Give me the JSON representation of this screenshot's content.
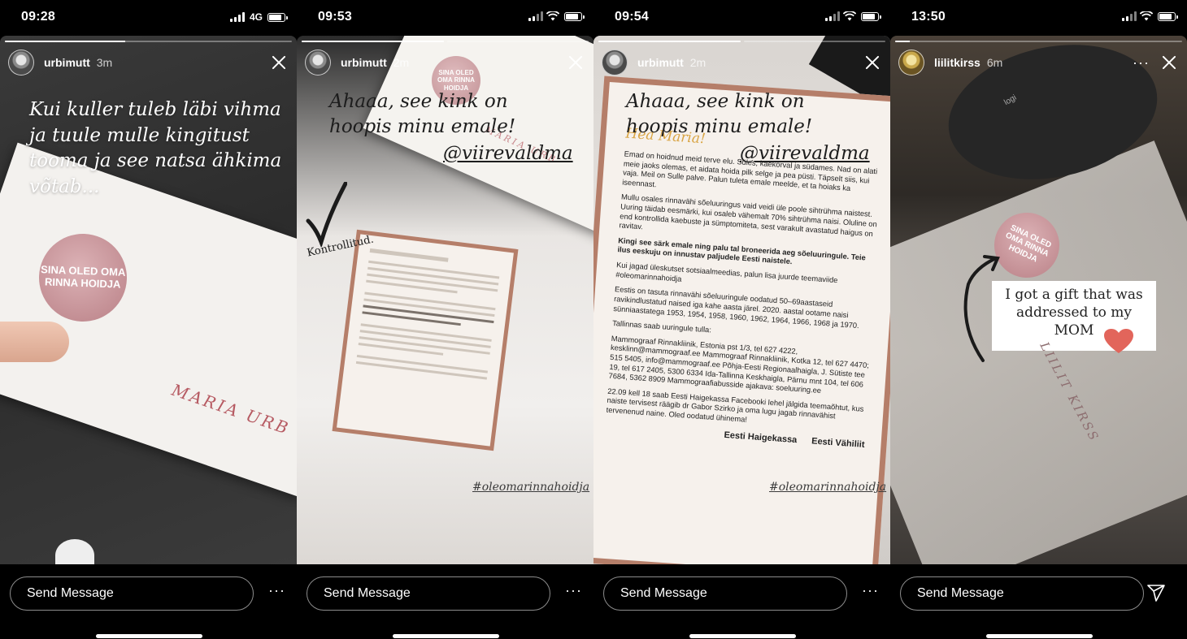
{
  "message_placeholder": "Send Message",
  "more_label": "···",
  "stories": [
    {
      "time": "09:28",
      "network": "4G",
      "username": "urbimutt",
      "ago": "3m",
      "caption": "Kui kuller tuleb läbi vihma ja tuule mulle kingitust tooma ja see natsa ähkima võtab...",
      "sticker": "SINA OLED OMA RINNA HOIDJA",
      "handwriting": "MARIA URB",
      "progress": 0.42
    },
    {
      "time": "09:53",
      "username": "urbimutt",
      "ago": "2m",
      "caption": "Ahaaa, see kink on hoopis minu emale!",
      "mention": "@viirevaldma",
      "check_label": "Kontrollitud.",
      "sticker": "SINA OLED OMA RINNA HOIDJA",
      "handwriting": "MARIA URB",
      "hashtag": "#oleomarinnahoidja",
      "progress": 0.5
    },
    {
      "time": "09:54",
      "username": "urbimutt",
      "ago": "2m",
      "caption": "Ahaaa, see kink on hoopis minu emale!",
      "mention": "@viirevaldma",
      "hashtag": "#oleomarinnahoidja",
      "greeting": "Hea Maria!",
      "letter_paragraphs": [
        "Emad on hoidnud meid terve elu. Süles, käekõrval ja südames. Nad on alati meie jaoks olemas, et aidata hoida pilk selge ja pea püsti. Täpselt siis, kui vaja. Meil on Sulle palve. Palun tuleta emale meelde, et ta hoiaks ka iseennast.",
        "Mullu osales rinnavähi sõeluuringus vaid veidi üle poole sihtrühma naistest. Uuring täidab eesmärki, kui osaleb vähemalt 70% sihtrühma naisi. Oluline on end kontrollida kaebuste ja sümptomiteta, sest varakult avastatud haigus on ravitav.",
        "Kingi see särk emale ning palu tal broneerida aeg sõeluuringule. Teie ilus eeskuju on innustav paljudele Eesti naistele.",
        "Kui jagad üleskutset sotsiaalmeedias, palun lisa juurde teemaviide #oleomarinnahoidja",
        "Eestis on tasuta rinnavähi sõeluuringule oodatud 50–69aastaseid ravikindlustatud naised iga kahe aasta järel. 2020. aastal ootame naisi sünniaastatega 1953, 1954, 1958, 1960, 1962, 1964, 1966, 1968 ja 1970.",
        "Tallinnas saab uuringule tulla:",
        "Mammograaf Rinnakliinik, Estonia pst 1/3, tel 627 4222, kesklinn@mammograaf.ee Mammograaf Rinnakliinik, Kotka 12, tel 627 4470; 515 5405, info@mammograaf.ee Põhja-Eesti Regionaalhaigla, J. Sütiste tee 19, tel 617 2405, 5300 6334 Ida-Tallinna Keskhaigla, Pärnu mnt 104, tel 606 7684, 5362 8909 Mammograafiabusside ajakava: soeluuring.ee",
        "22.09 kell 18 saab Eesti Haigekassa Facebooki lehel jälgida teemaõhtut, kus naiste tervisest räägib dr Gabor Szirko ja oma lugu jagab rinnavähist tervenenud naine. Oled oodatud ühinema!"
      ],
      "logo_1": "Eesti Haigekassa",
      "logo_2": "Eesti Vähiliit",
      "progress": 0.5
    },
    {
      "time": "13:50",
      "username": "liilitkirss",
      "ago": "6m",
      "caption": "I got a gift that was addressed to my MOM",
      "sticker": "SINA OLED OMA RINNA HOIDJA",
      "handwriting": "LIILIT KIRSS",
      "mouse_brand": "logi",
      "progress": 0.05
    }
  ]
}
